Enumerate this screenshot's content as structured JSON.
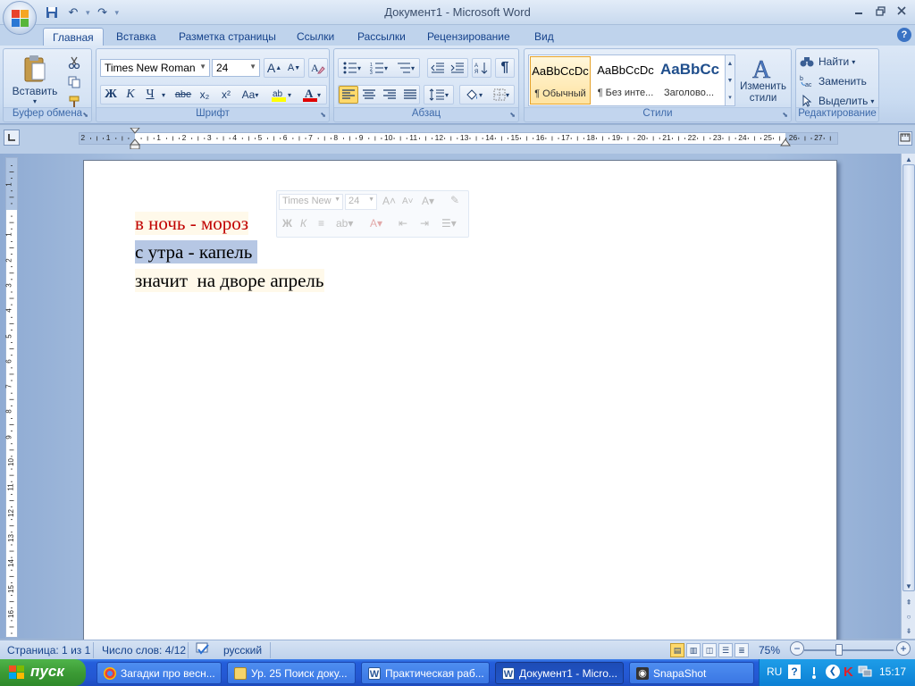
{
  "window": {
    "title": "Документ1 - Microsoft Word",
    "minimize": "▬",
    "restore": "❐",
    "close": "✕"
  },
  "qat": {
    "save": "💾",
    "undo": "↶",
    "redo": "↷",
    "customize": "▾"
  },
  "tabs": [
    {
      "label": "Главная",
      "active": true
    },
    {
      "label": "Вставка"
    },
    {
      "label": "Разметка страницы"
    },
    {
      "label": "Ссылки"
    },
    {
      "label": "Рассылки"
    },
    {
      "label": "Рецензирование"
    },
    {
      "label": "Вид"
    }
  ],
  "help": "?",
  "ribbon": {
    "clipboard": {
      "label": "Буфер обмена",
      "paste_label": "Вставить",
      "cut_icon": "scissors-icon",
      "copy_icon": "copy-icon",
      "format_painter_icon": "format-painter-icon"
    },
    "font": {
      "label": "Шрифт",
      "font_name": "Times New Roman",
      "font_size": "24",
      "grow": "A",
      "shrink": "A",
      "clear": "A",
      "bold": "Ж",
      "italic": "К",
      "underline": "Ч",
      "strike": "abe",
      "subscript": "x₂",
      "superscript": "x²",
      "case": "Aa"
    },
    "paragraph": {
      "label": "Абзац",
      "pilcrow": "¶"
    },
    "styles": {
      "label": "Стили",
      "items": [
        {
          "sample": "AaBbCcDc",
          "name": "¶ Обычный",
          "selected": true
        },
        {
          "sample": "AaBbCcDc",
          "name": "¶ Без инте..."
        },
        {
          "sample": "AaBbCc",
          "name": "Заголово..."
        }
      ],
      "change_styles": "Изменить стили"
    },
    "editing": {
      "label": "Редактирование",
      "find": "Найти",
      "replace": "Заменить",
      "select": "Выделить"
    }
  },
  "ruler": {
    "numbers": [
      "2",
      "1",
      "1",
      "2",
      "3",
      "4",
      "5",
      "6",
      "7",
      "8",
      "9",
      "10",
      "11",
      "12",
      "13",
      "14",
      "15",
      "16",
      "17",
      "18",
      "19",
      "20",
      "21",
      "22",
      "23",
      "24",
      "25",
      "26",
      "27"
    ],
    "vnumbers": [
      "2",
      "1",
      "1",
      "2",
      "3",
      "4",
      "5",
      "6",
      "7",
      "8",
      "9",
      "10",
      "11",
      "12",
      "13",
      "14",
      "15",
      "16"
    ]
  },
  "document": {
    "lines": [
      "в ночь - мороз",
      "с утра - капель",
      "значит  на дворе апрель"
    ]
  },
  "mini_toolbar": {
    "font": "Times New",
    "size": "24"
  },
  "statusbar": {
    "page": "Страница: 1 из 1",
    "words": "Число слов: 4/12",
    "language": "русский",
    "zoom": "75%",
    "zoom_minus": "−",
    "zoom_plus": "+",
    "zoom_level_fraction": 0.4
  },
  "taskbar": {
    "start": "пуск",
    "items": [
      {
        "label": "Загадки про весн...",
        "icon": "chrome-icon"
      },
      {
        "label": "Ур. 25 Поиск доку...",
        "icon": "folder-icon"
      },
      {
        "label": "Практическая раб...",
        "icon": "word-icon"
      },
      {
        "label": "Документ1 - Micro...",
        "icon": "word-icon",
        "active": true
      },
      {
        "label": "SnapaShot",
        "icon": "camera-icon"
      }
    ],
    "lang": "RU",
    "time": "15:17"
  },
  "colors": {
    "line1_text": "#c00000",
    "selection": "#b6c7e4",
    "ribbon": "#c9dbf1",
    "taskbar": "#245edb",
    "start": "#3c9b35"
  }
}
